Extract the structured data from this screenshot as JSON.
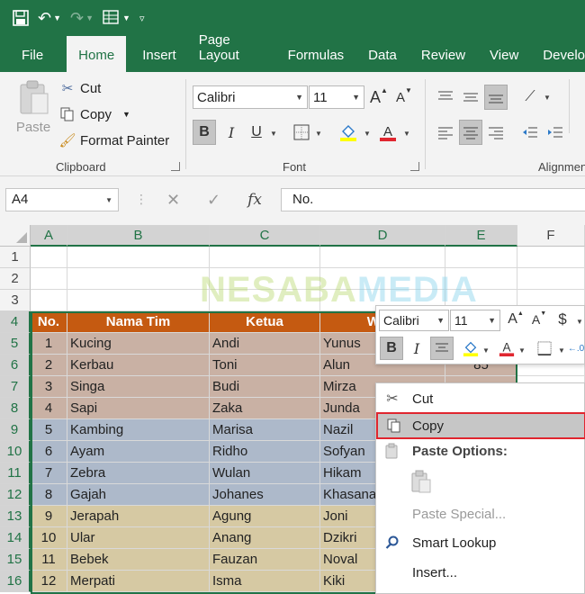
{
  "app": {
    "qa_undo_icon": "undo-icon",
    "qa_redo_icon": "redo-icon"
  },
  "tabs": [
    {
      "label": "File"
    },
    {
      "label": "Home",
      "active": true
    },
    {
      "label": "Insert"
    },
    {
      "label": "Page Layout"
    },
    {
      "label": "Formulas"
    },
    {
      "label": "Data"
    },
    {
      "label": "Review"
    },
    {
      "label": "View"
    },
    {
      "label": "Develo"
    }
  ],
  "ribbon": {
    "clipboard": {
      "paste_label": "Paste",
      "cut_label": "Cut",
      "copy_label": "Copy",
      "format_painter_label": "Format Painter",
      "group_label": "Clipboard"
    },
    "font": {
      "family": "Calibri",
      "size": "11",
      "group_label": "Font",
      "bold": "B",
      "italic": "I",
      "underline": "U",
      "grow": "A",
      "shrink": "A",
      "fill_color": "#FFFF00",
      "font_color": "#E0262F"
    },
    "alignment": {
      "group_label": "Alignmen"
    }
  },
  "formula_bar": {
    "name_box": "A4",
    "fx": "fx",
    "content": "No."
  },
  "grid": {
    "columns": [
      "A",
      "B",
      "C",
      "D",
      "E",
      "F"
    ],
    "rows": [
      "1",
      "2",
      "3",
      "4",
      "5",
      "6",
      "7",
      "8",
      "9",
      "10",
      "11",
      "12",
      "13",
      "14",
      "15",
      "16"
    ],
    "header": {
      "no": "No.",
      "nama_tim": "Nama Tim",
      "ketua": "Ketua",
      "wakil": "Waki"
    },
    "data": [
      {
        "no": "1",
        "tim": "Kucing",
        "ketua": "Andi",
        "wakil": "Yunus",
        "e": ""
      },
      {
        "no": "2",
        "tim": "Kerbau",
        "ketua": "Toni",
        "wakil": "Alun",
        "e": "85"
      },
      {
        "no": "3",
        "tim": "Singa",
        "ketua": "Budi",
        "wakil": "Mirza",
        "e": ""
      },
      {
        "no": "4",
        "tim": "Sapi",
        "ketua": "Zaka",
        "wakil": "Junda",
        "e": ""
      },
      {
        "no": "5",
        "tim": "Kambing",
        "ketua": "Marisa",
        "wakil": "Nazil",
        "e": ""
      },
      {
        "no": "6",
        "tim": "Ayam",
        "ketua": "Ridho",
        "wakil": "Sofyan",
        "e": ""
      },
      {
        "no": "7",
        "tim": "Zebra",
        "ketua": "Wulan",
        "wakil": "Hikam",
        "e": ""
      },
      {
        "no": "8",
        "tim": "Gajah",
        "ketua": "Johanes",
        "wakil": "Khasanah",
        "e": ""
      },
      {
        "no": "9",
        "tim": "Jerapah",
        "ketua": "Agung",
        "wakil": "Joni",
        "e": ""
      },
      {
        "no": "10",
        "tim": "Ular",
        "ketua": "Anang",
        "wakil": "Dzikri",
        "e": ""
      },
      {
        "no": "11",
        "tim": "Bebek",
        "ketua": "Fauzan",
        "wakil": "Noval",
        "e": ""
      },
      {
        "no": "12",
        "tim": "Merpati",
        "ketua": "Isma",
        "wakil": "Kiki",
        "e": ""
      }
    ],
    "colors": {
      "header_orange": "#C55A11",
      "header_no": "#F4B183",
      "band_1": "#C9B1A4",
      "band_2": "#ADB9CA",
      "band_3": "#D6C9A3",
      "selection": "#217346"
    }
  },
  "watermark": {
    "part1": "NESABA",
    "part2": "MEDIA"
  },
  "mini_toolbar": {
    "font": "Calibri",
    "size": "11",
    "currency": "$",
    "bold": "B",
    "italic": "I"
  },
  "context_menu": {
    "cut": "Cut",
    "copy": "Copy",
    "paste_options": "Paste Options:",
    "paste_special": "Paste Special...",
    "smart_lookup": "Smart Lookup",
    "insert": "Insert..."
  }
}
